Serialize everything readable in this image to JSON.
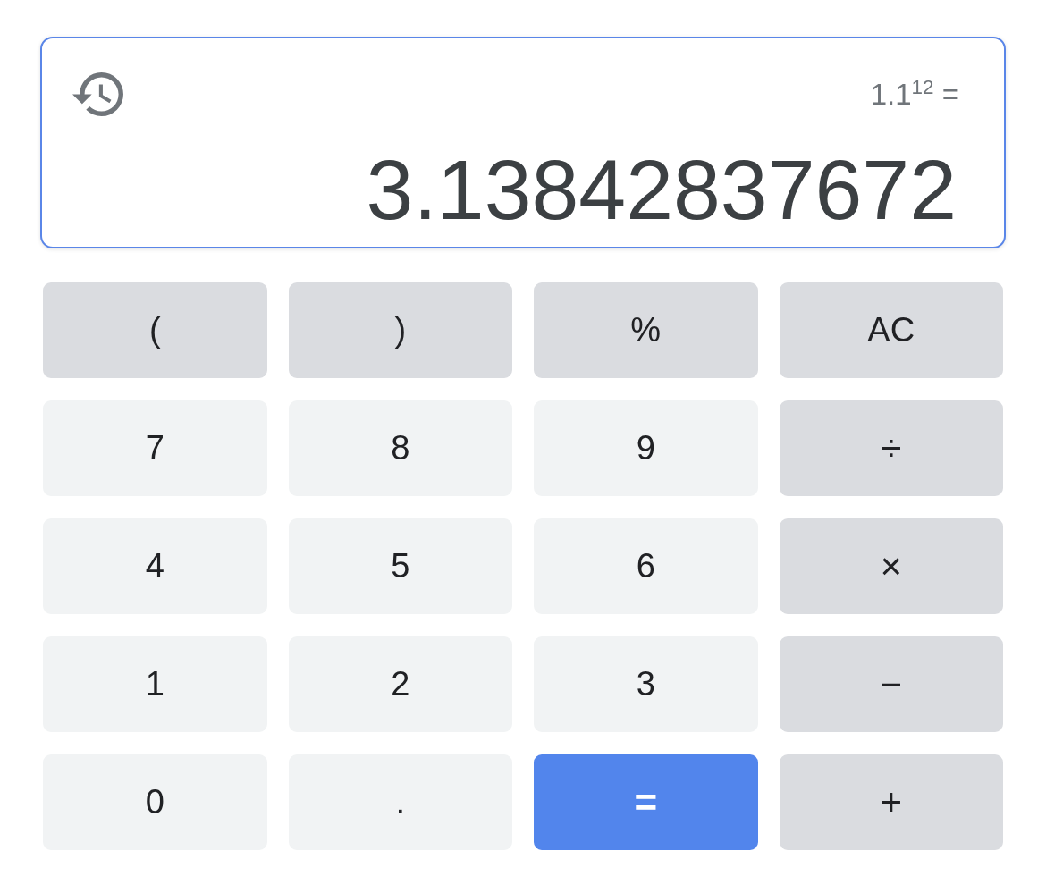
{
  "display": {
    "focused": true,
    "expression": "1.1$^{12}$ =",
    "result": "3.13842837672"
  },
  "keypad": {
    "rows": [
      {
        "keys": [
          {
            "label": "(",
            "kind": "function"
          },
          {
            "label": ")",
            "kind": "function"
          },
          {
            "label": "%",
            "kind": "function"
          },
          {
            "label": "AC",
            "kind": "function"
          }
        ]
      },
      {
        "keys": [
          {
            "label": "7",
            "kind": "digit"
          },
          {
            "label": "8",
            "kind": "digit"
          },
          {
            "label": "9",
            "kind": "digit"
          },
          {
            "label": "÷",
            "kind": "operator"
          }
        ]
      },
      {
        "keys": [
          {
            "label": "4",
            "kind": "digit"
          },
          {
            "label": "5",
            "kind": "digit"
          },
          {
            "label": "6",
            "kind": "digit"
          },
          {
            "label": "×",
            "kind": "operator"
          }
        ]
      },
      {
        "keys": [
          {
            "label": "1",
            "kind": "digit"
          },
          {
            "label": "2",
            "kind": "digit"
          },
          {
            "label": "3",
            "kind": "digit"
          },
          {
            "label": "−",
            "kind": "operator"
          }
        ]
      },
      {
        "keys": [
          {
            "label": "0",
            "kind": "digit"
          },
          {
            "label": ".",
            "kind": "digit"
          },
          {
            "label": "=",
            "kind": "equals"
          },
          {
            "label": "+",
            "kind": "operator"
          }
        ]
      }
    ]
  }
}
